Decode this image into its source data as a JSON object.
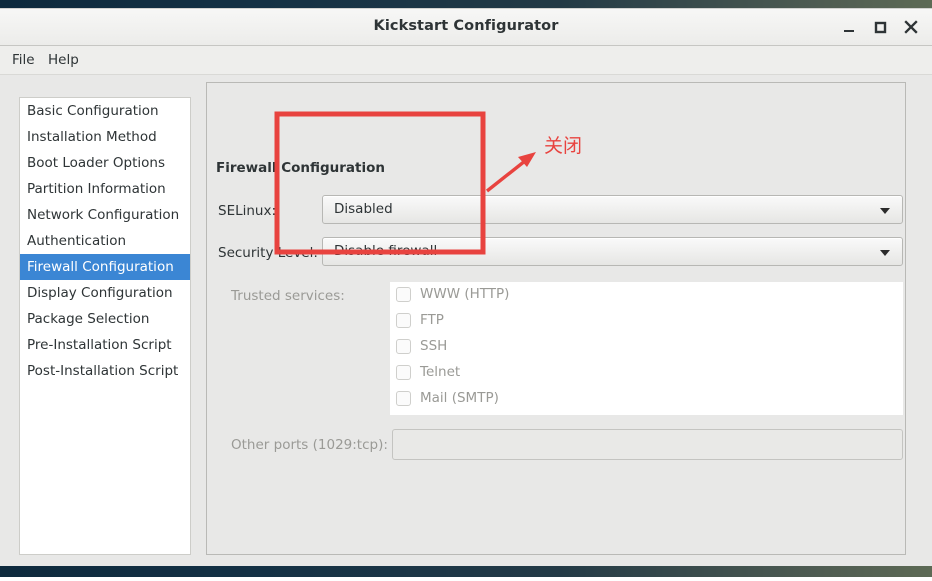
{
  "window": {
    "title": "Kickstart Configurator",
    "controls": [
      {
        "name": "minimize",
        "glyph": "minimize-icon"
      },
      {
        "name": "maximize",
        "glyph": "maximize-icon"
      },
      {
        "name": "close",
        "glyph": "close-icon"
      }
    ]
  },
  "menubar": {
    "items": [
      {
        "label": "File"
      },
      {
        "label": "Help"
      }
    ]
  },
  "sidebar": {
    "selected_index": 6,
    "items": [
      {
        "label": "Basic Configuration"
      },
      {
        "label": "Installation Method"
      },
      {
        "label": "Boot Loader Options"
      },
      {
        "label": "Partition Information"
      },
      {
        "label": "Network Configuration"
      },
      {
        "label": "Authentication"
      },
      {
        "label": "Firewall Configuration"
      },
      {
        "label": "Display Configuration"
      },
      {
        "label": "Package Selection"
      },
      {
        "label": "Pre-Installation Script"
      },
      {
        "label": "Post-Installation Script"
      }
    ]
  },
  "main": {
    "frame_title": "Firewall Configuration",
    "selinux": {
      "label": "SELinux:",
      "value": "Disabled"
    },
    "security_level": {
      "label": "Security Level:",
      "value": "Disable firewall"
    },
    "trusted_services": {
      "label": "Trusted services:",
      "items": [
        {
          "label": "WWW (HTTP)",
          "checked": false
        },
        {
          "label": "FTP",
          "checked": false
        },
        {
          "label": "SSH",
          "checked": false
        },
        {
          "label": "Telnet",
          "checked": false
        },
        {
          "label": "Mail (SMTP)",
          "checked": false
        }
      ]
    },
    "other_ports": {
      "label": "Other ports (1029:tcp):",
      "value": "",
      "placeholder": ""
    }
  },
  "annotation": {
    "text": "关闭",
    "color": "#e8433f"
  },
  "colors": {
    "accent_selection": "#3b86d4",
    "window_bg": "#e8e8e7",
    "annotation_red": "#e8433f",
    "text": "#2e3436",
    "text_disabled": "#9a9a96"
  }
}
